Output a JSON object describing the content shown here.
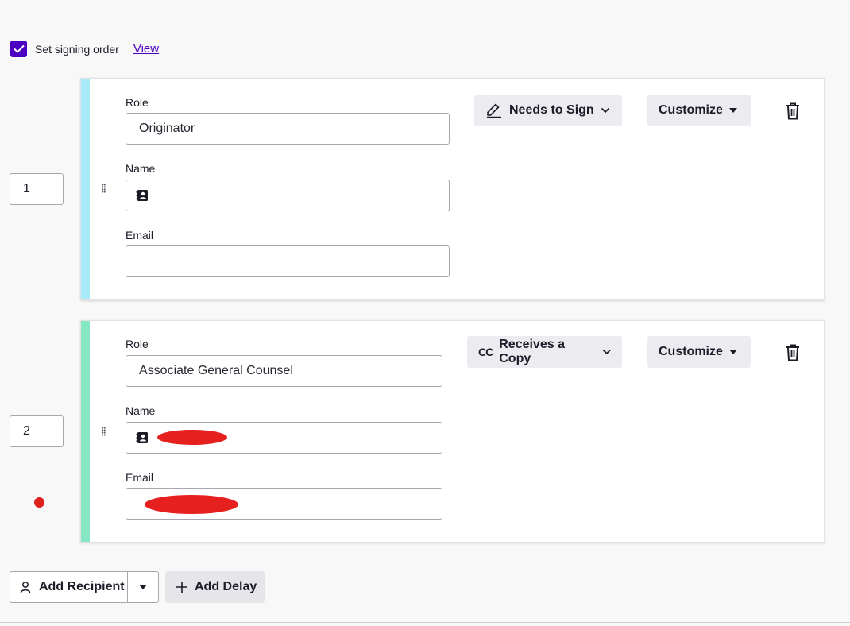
{
  "signing_order": {
    "label": "Set signing order",
    "checked": true,
    "view_link": "View"
  },
  "recipients": [
    {
      "order": "1",
      "stripe_color": "#a8eaf8",
      "role_label": "Role",
      "role_value": "Originator",
      "name_label": "Name",
      "name_value": "",
      "email_label": "Email",
      "email_value": "",
      "action": {
        "label": "Needs to Sign",
        "icon": "pen-icon"
      },
      "customize_label": "Customize"
    },
    {
      "order": "2",
      "stripe_color": "#86e8c3",
      "role_label": "Role",
      "role_value": "Associate General Counsel",
      "name_label": "Name",
      "name_value": "",
      "email_label": "Email",
      "email_value": "",
      "action": {
        "label": "Receives a Copy",
        "icon": "cc-icon",
        "icon_text": "CC"
      },
      "customize_label": "Customize"
    }
  ],
  "footer": {
    "add_recipient_label": "Add Recipient",
    "add_delay_label": "Add Delay"
  },
  "colors": {
    "accent": "#4c00c2",
    "error": "#e0201c"
  }
}
